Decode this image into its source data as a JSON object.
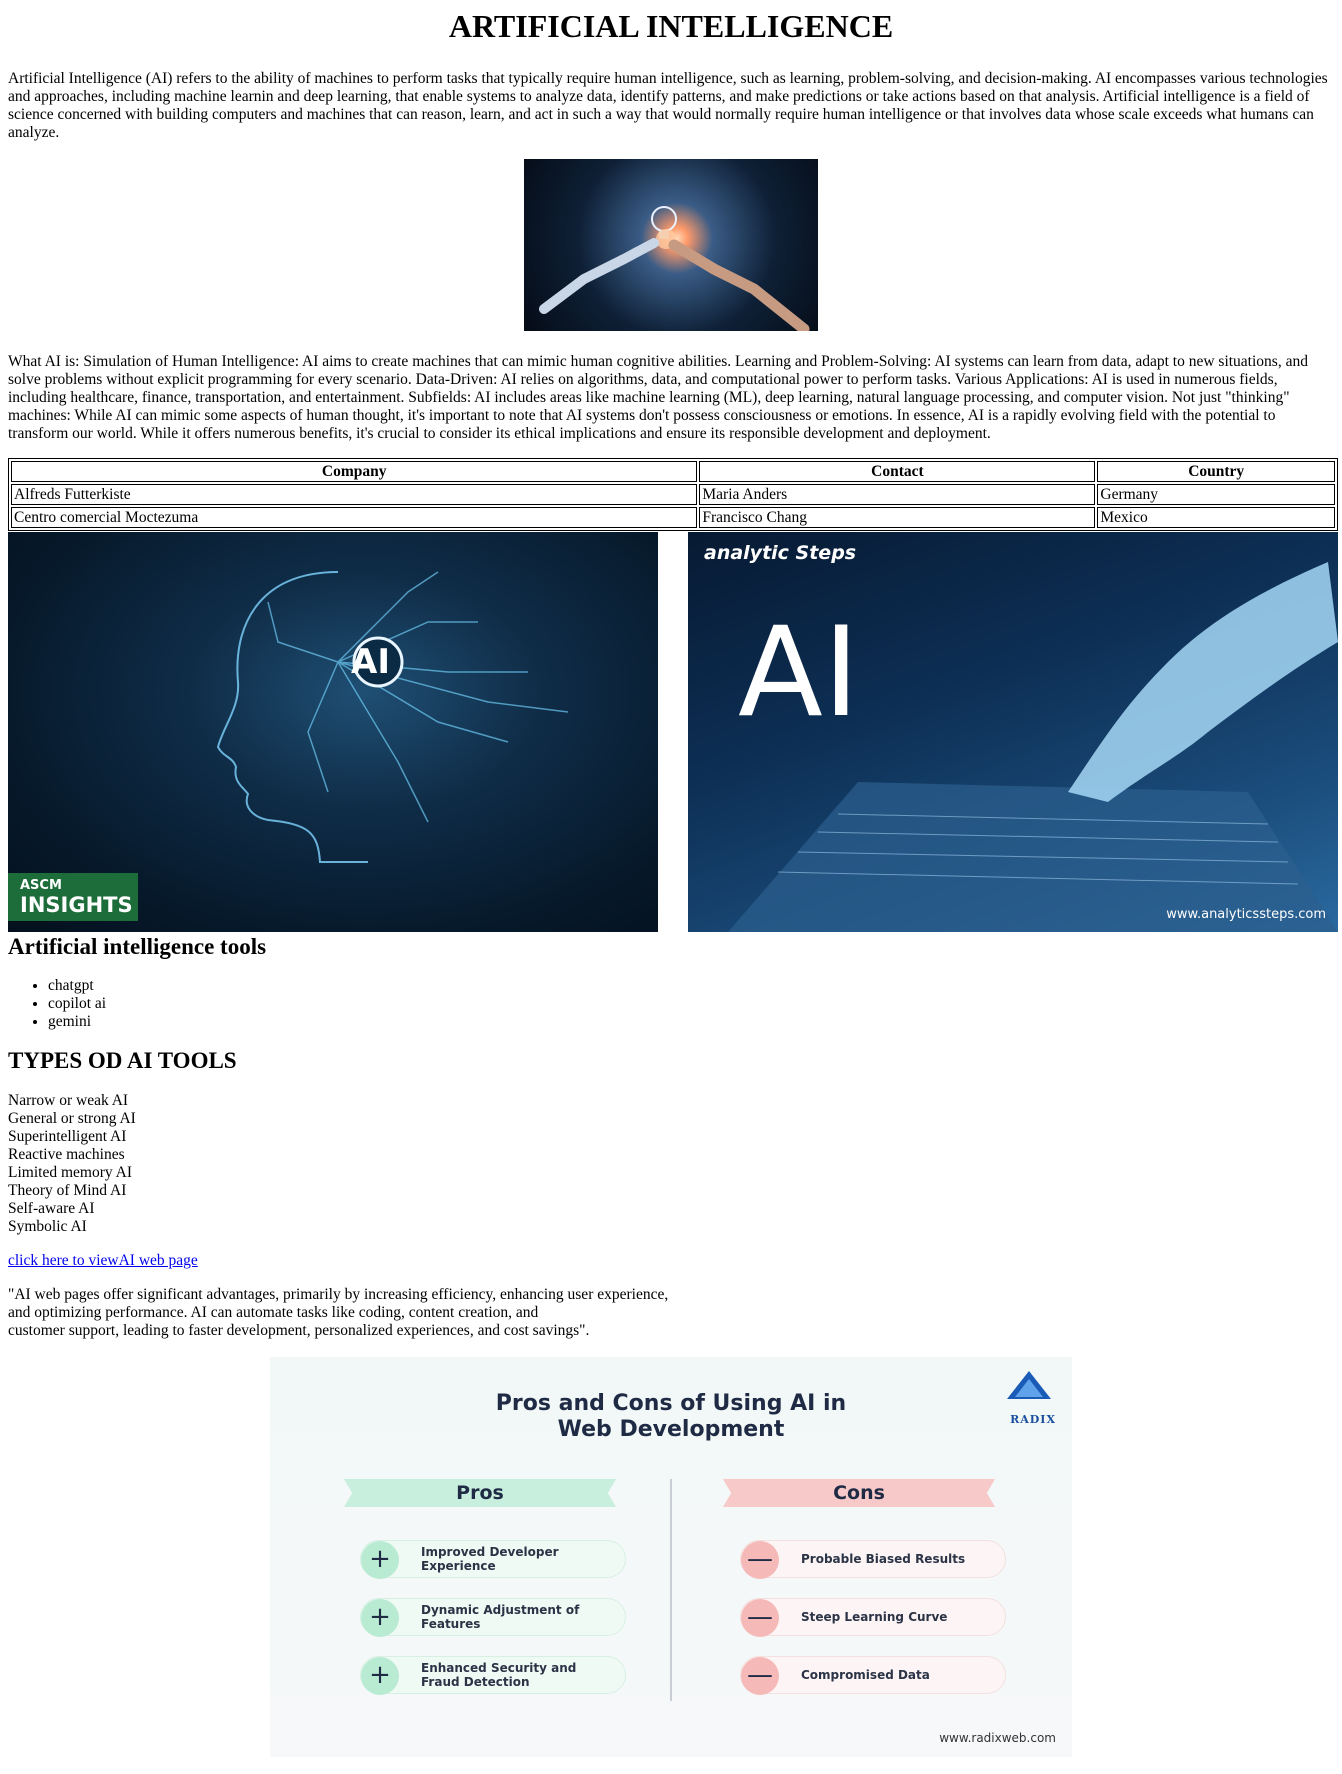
{
  "title": "ARTIFICIAL INTELLIGENCE",
  "intro": "Artificial Intelligence (AI) refers to the ability of machines to perform tasks that typically require human intelligence, such as learning, problem-solving, and decision-making. AI encompasses various technologies and approaches, including machine learnin and deep learning, that enable systems to analyze data, identify patterns, and make predictions or take actions based on that analysis. Artificial intelligence is a field of science concerned with building computers and machines that can reason, learn, and act in such a way that would normally require human intelligence or that involves data whose scale exceeds what humans can analyze.",
  "description": "What AI is: Simulation of Human Intelligence: AI aims to create machines that can mimic human cognitive abilities. Learning and Problem-Solving: AI systems can learn from data, adapt to new situations, and solve problems without explicit programming for every scenario. Data-Driven: AI relies on algorithms, data, and computational power to perform tasks. Various Applications: AI is used in numerous fields, including healthcare, finance, transportation, and entertainment. Subfields: AI includes areas like machine learning (ML), deep learning, natural language processing, and computer vision. Not just \"thinking\" machines: While AI can mimic some aspects of human thought, it's important to note that AI systems don't possess consciousness or emotions. In essence, AI is a rapidly evolving field with the potential to transform our world. While it offers numerous benefits, it's crucial to consider its ethical implications and ensure its responsible development and deployment.",
  "table": {
    "headers": [
      "Company",
      "Contact",
      "Country"
    ],
    "rows": [
      [
        "Alfreds Futterkiste",
        "Maria Anders",
        "Germany"
      ],
      [
        "Centro comercial Moctezuma",
        "Francisco Chang",
        "Mexico"
      ]
    ]
  },
  "images": {
    "left": {
      "center_text": "AI",
      "badge_top": "ASCM",
      "badge_bottom": "INSIGHTS"
    },
    "right": {
      "brand": "analytic Steps",
      "big_text": "AI",
      "url": "www.analyticssteps.com"
    }
  },
  "tools": {
    "heading": "Artificial intelligence tools",
    "items": [
      "chatgpt",
      "copilot ai",
      "gemini"
    ]
  },
  "types": {
    "heading": "TYPES OD AI TOOLS",
    "items": [
      "Narrow or weak AI",
      "General or strong AI",
      "Superintelligent AI",
      "Reactive machines",
      "Limited memory AI",
      "Theory of Mind AI",
      "Self-aware AI",
      "Symbolic AI"
    ]
  },
  "link_text": "click here to viewAI web page",
  "quote_lines": [
    "\"AI web pages offer significant advantages, primarily by increasing efficiency, enhancing user experience,",
    "and optimizing performance. AI can automate tasks like coding, content creation, and",
    "customer support, leading to faster development, personalized experiences, and cost savings\"."
  ],
  "proscons": {
    "title_line1": "Pros and Cons of Using AI in",
    "title_line2": "Web Development",
    "brand": "RADIX",
    "pros_label": "Pros",
    "cons_label": "Cons",
    "pros": [
      "Improved Developer Experience",
      "Dynamic Adjustment of Features",
      "Enhanced Security and Fraud Detection"
    ],
    "cons": [
      "Probable Biased Results",
      "Steep Learning Curve",
      "Compromised Data"
    ],
    "pro_symbol": "+",
    "con_symbol": "—",
    "url": "www.radixweb.com"
  },
  "colors": {
    "link": "#0000ee",
    "pros_banner": "#c8eede",
    "cons_banner": "#f7c9c8",
    "image_dark_blue": "#0f2c47"
  }
}
